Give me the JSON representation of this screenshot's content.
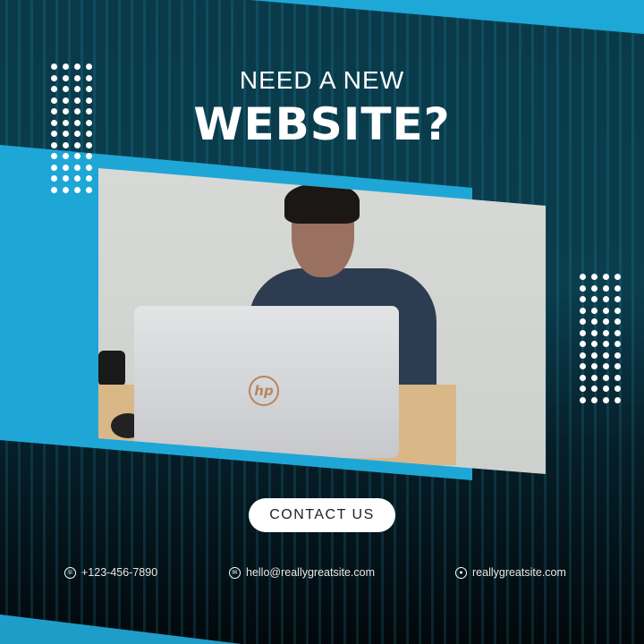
{
  "headline": {
    "line1": "NEED A NEW",
    "line2": "WEBSITE?"
  },
  "photo": {
    "laptop_logo": "hp"
  },
  "cta": {
    "label": "CONTACT US"
  },
  "contacts": [
    {
      "icon": "phone-icon",
      "text": "+123-456-7890"
    },
    {
      "icon": "mail-icon",
      "text": "hello@reallygreatsite.com"
    },
    {
      "icon": "globe-icon",
      "text": "reallygreatsite.com"
    }
  ],
  "colors": {
    "accent": "#1ea7d6",
    "background": "#0a3a4a",
    "button": "#ffffff"
  }
}
